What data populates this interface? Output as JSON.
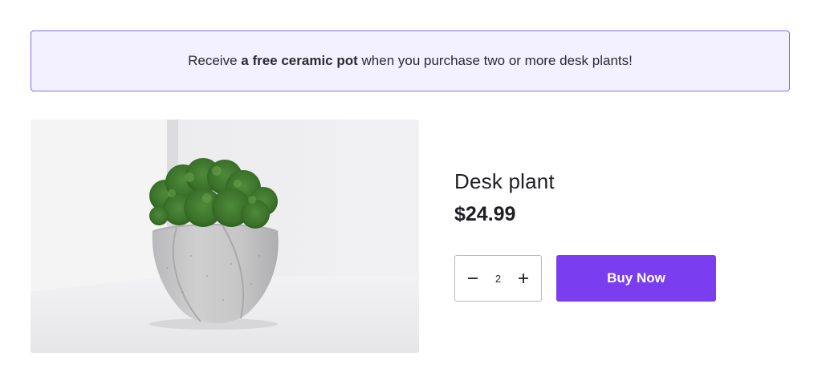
{
  "banner": {
    "prefix": "Receive ",
    "highlight": "a free ceramic pot",
    "suffix": " when you purchase two or more desk plants!"
  },
  "product": {
    "name": "Desk plant",
    "price": "$24.99",
    "image_subject": "moss plant in grey concrete pot"
  },
  "quantity": {
    "decrement_icon": "minus-icon",
    "value": "2",
    "increment_icon": "plus-icon"
  },
  "buy_button": {
    "label": "Buy Now"
  },
  "colors": {
    "accent": "#7a3df0",
    "banner_bg": "#f3f0ff",
    "banner_border": "#8b6cf0"
  }
}
